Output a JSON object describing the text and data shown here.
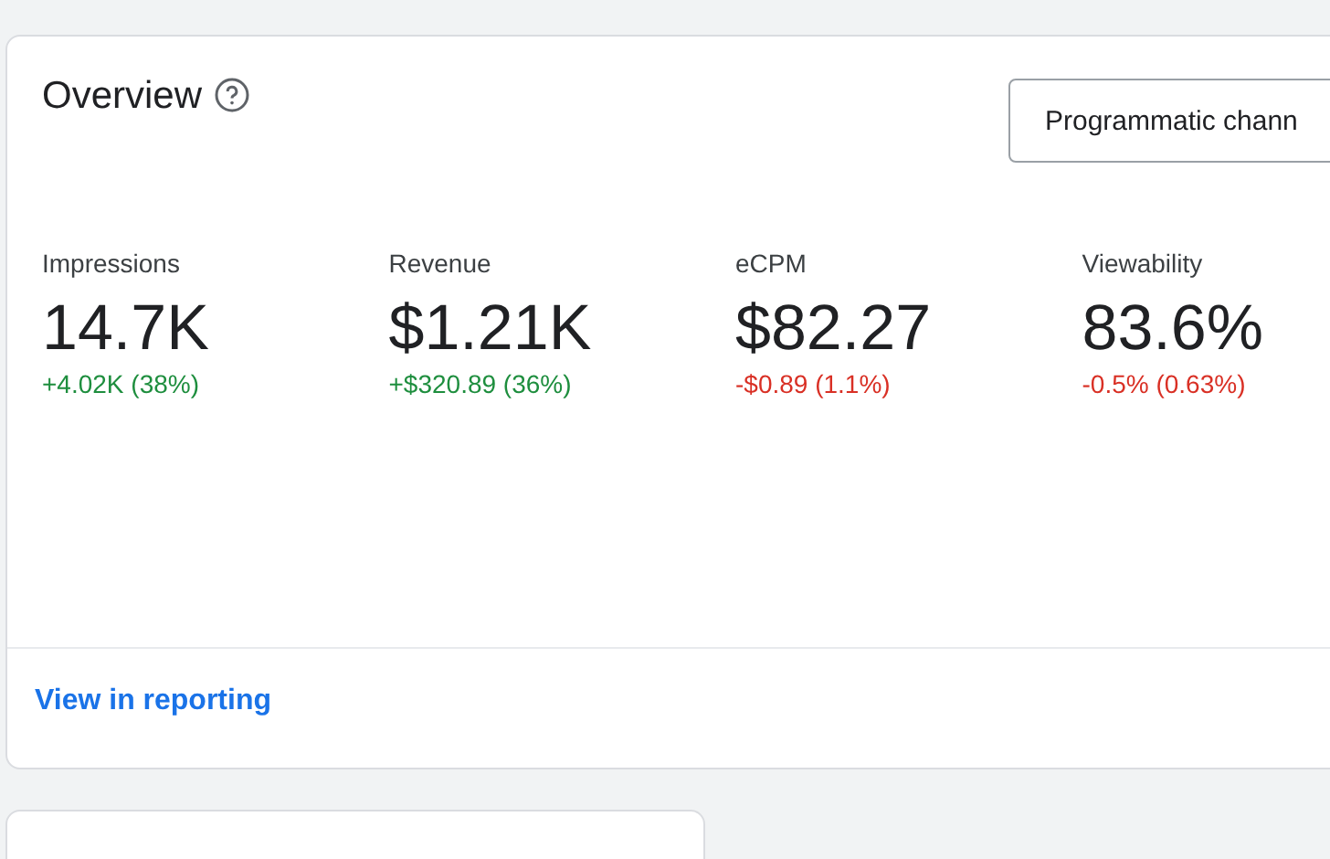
{
  "overview": {
    "title": "Overview",
    "filter": {
      "value": "Programmatic chann"
    },
    "metrics": [
      {
        "label": "Impressions",
        "value": "14.7K",
        "change": "+4.02K (38%)",
        "kind": "up"
      },
      {
        "label": "Revenue",
        "value": "$1.21K",
        "change": "+$320.89 (36%)",
        "kind": "up"
      },
      {
        "label": "eCPM",
        "value": "$82.27",
        "change": "-$0.89 (1.1%)",
        "kind": "down"
      },
      {
        "label": "Viewability",
        "value": "83.6%",
        "change": "-0.5% (0.63%)",
        "kind": "down"
      }
    ],
    "link": "View in reporting"
  }
}
